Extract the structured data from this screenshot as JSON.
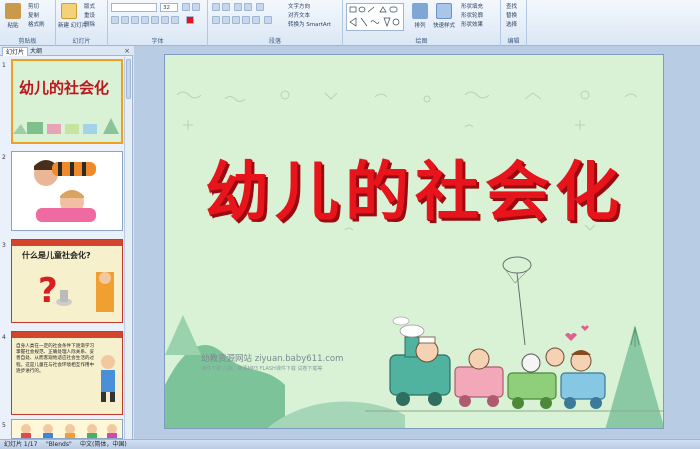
{
  "ribbon": {
    "clipboard": {
      "paste": "粘贴",
      "cut": "剪切",
      "copy": "复制",
      "format": "格式刷",
      "label": "剪贴板"
    },
    "slides": {
      "new_slide": "新建\n幻灯片",
      "layout": "版式",
      "reset": "重设",
      "delete": "删除",
      "label": "幻灯片"
    },
    "font": {
      "font_name": "",
      "font_size": "32",
      "label": "字体"
    },
    "paragraph": {
      "text_direction": "文字方向",
      "align_text": "对齐文本",
      "smartart": "转换为 SmartArt",
      "label": "段落"
    },
    "drawing": {
      "arrange": "排列",
      "quick_styles": "快速样式",
      "shape_fill": "形状填充",
      "shape_outline": "形状轮廓",
      "shape_effects": "形状效果",
      "label": "绘图"
    },
    "editing": {
      "find": "查找",
      "replace": "替换",
      "select": "选择",
      "label": "编辑"
    }
  },
  "panel": {
    "tab_slides": "幻灯片",
    "tab_outline": "大纲",
    "close": "×",
    "thumbs": [
      {
        "num": "1",
        "title": "幼儿的社会化"
      },
      {
        "num": "2"
      },
      {
        "num": "3",
        "title": "什么是儿童社会化?"
      },
      {
        "num": "4",
        "text": "自身人类在一定的社会条件下逐渐学习掌握社会规范、正确处理人际关系、妥善自处、从而客观地适应社会生活的过程。这是儿童在与社会环境相互作用中逐步进行的。"
      },
      {
        "num": "5"
      }
    ]
  },
  "slide": {
    "title": "幼儿的社会化",
    "watermark": "幼教资源网站  ziyuan.baby611.com",
    "watermark2": "课件下载  儿歌、故事MP3  FLASH课件下载  试卷下载等"
  },
  "status": {
    "slide_of": "幻灯片 1/17",
    "theme": "\"Blends\"",
    "lang": "中文(简体，中国)"
  },
  "colors": {
    "title_red": "#e8141c",
    "slide_bg": "#d9f2d6",
    "ribbon_blue": "#dbe7f5"
  }
}
